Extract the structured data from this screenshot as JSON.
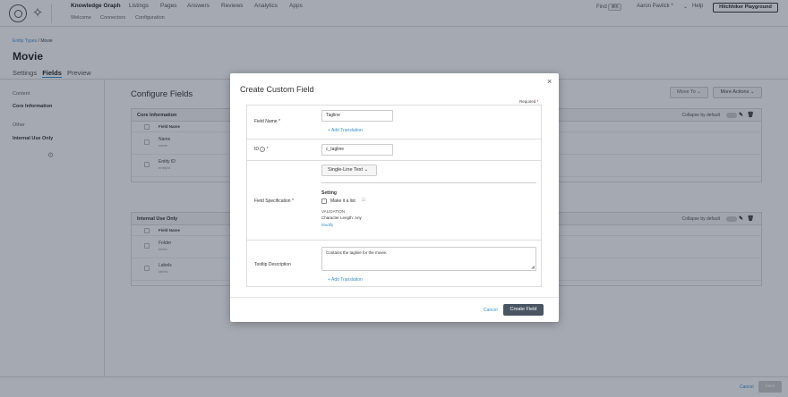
{
  "topnav": {
    "items": [
      "Knowledge Graph",
      "Listings",
      "Pages",
      "Answers",
      "Reviews",
      "Analytics",
      "Apps"
    ],
    "subitems": [
      "Welcome",
      "Connectors",
      "Configuration"
    ],
    "find": "Find",
    "find_key": "⌘K",
    "user": "Aaron Pavlick *",
    "help": "Help",
    "account": "Hitchhiker Playground"
  },
  "page": {
    "breadcrumb_parent": "Entity Types",
    "breadcrumb_sep": " / ",
    "breadcrumb_current": "Movie",
    "title": "Movie",
    "tabs": [
      "Settings",
      "Fields",
      "Preview"
    ]
  },
  "sidebar": {
    "content_heading": "Content",
    "content_item": "Core Information",
    "other_heading": "Other",
    "other_item": "Internal Use Only"
  },
  "main": {
    "title": "Configure Fields",
    "move_to": "Move To",
    "more_actions": "More Actions",
    "collapse": "Collapse by default",
    "col_header": "Field Name",
    "core": {
      "title": "Core Information",
      "rows": [
        {
          "name": "Name",
          "sub": "name"
        },
        {
          "name": "Entity ID",
          "sub": "entityId"
        }
      ]
    },
    "internal": {
      "title": "Internal Use Only",
      "rows": [
        {
          "name": "Folder",
          "sub": "folder"
        },
        {
          "name": "Labels",
          "sub": "labels"
        }
      ]
    }
  },
  "footer": {
    "cancel": "Cancel",
    "save": "Save"
  },
  "modal": {
    "title": "Create Custom Field",
    "close": "×",
    "required": "Required",
    "req_star": "*",
    "field_name_label": "Field Name",
    "field_name_value": "Tagline",
    "add_translation": "+ Add Translation",
    "id_label": "ID",
    "id_value": "c_tagline",
    "spec_label": "Field Specification",
    "spec_value": "Single-Line Text",
    "setting": "Setting",
    "make_list": "Make it a list",
    "validation": "VALIDATION",
    "char_length": "Character Length: Any",
    "modify": "Modify",
    "tooltip_label": "Tooltip Description",
    "tooltip_value": "Contains the tagline for the movie.",
    "add_translation_2": "+ Add Translation",
    "cancel": "Cancel",
    "create": "Create Field"
  }
}
